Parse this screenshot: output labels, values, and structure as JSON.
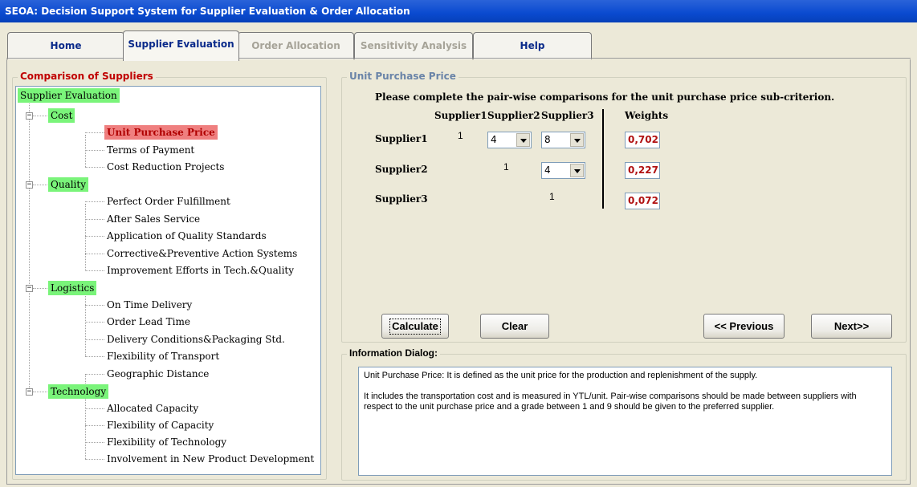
{
  "window": {
    "title": "SEOA: Decision Support System for Supplier Evaluation & Order Allocation"
  },
  "tabs": [
    {
      "label": "Home",
      "state": "enabled"
    },
    {
      "label": "Supplier Evaluation",
      "state": "active"
    },
    {
      "label": "Order Allocation",
      "state": "disabled"
    },
    {
      "label": "Sensitivity Analysis",
      "state": "disabled"
    },
    {
      "label": "Help",
      "state": "enabled"
    }
  ],
  "left_panel": {
    "title": "Comparison of Suppliers",
    "tree": {
      "root": "Supplier Evaluation",
      "categories": [
        {
          "label": "Cost",
          "children": [
            "Unit Purchase Price",
            "Terms of Payment",
            "Cost Reduction Projects"
          ]
        },
        {
          "label": "Quality",
          "children": [
            "Perfect Order Fulfillment",
            "After Sales Service",
            "Application of Quality Standards",
            "Corrective&Preventive Action Systems",
            "Improvement Efforts in Tech.&Quality"
          ]
        },
        {
          "label": "Logistics",
          "children": [
            "On Time Delivery",
            "Order Lead Time",
            "Delivery Conditions&Packaging Std.",
            "Flexibility of Transport",
            "Geographic Distance"
          ]
        },
        {
          "label": "Technology",
          "children": [
            "Allocated Capacity",
            "Flexibility of Capacity",
            "Flexibility of Technology",
            "Involvement in New Product Development"
          ]
        }
      ],
      "selected": "Unit Purchase Price",
      "expander_symbol": "−"
    }
  },
  "right_panel": {
    "title": "Unit Purchase Price",
    "instruction": "Please complete the pair-wise comparisons for the unit purchase price sub-criterion.",
    "column_headers": [
      "Supplier1",
      "Supplier2",
      "Supplier3"
    ],
    "weights_header": "Weights",
    "rows": [
      {
        "label": "Supplier1",
        "diag": "1",
        "comparisons": [
          "4",
          "8"
        ],
        "weight": "0,702"
      },
      {
        "label": "Supplier2",
        "diag": "1",
        "comparisons": [
          "4"
        ],
        "weight": "0,227"
      },
      {
        "label": "Supplier3",
        "diag": "1",
        "comparisons": [],
        "weight": "0,072"
      }
    ],
    "buttons": {
      "calculate": "Calculate",
      "clear": "Clear",
      "previous": "<< Previous",
      "next": "Next>>"
    }
  },
  "info_dialog": {
    "title": "Information Dialog:",
    "paragraphs": [
      "Unit Purchase Price: It is defined as the unit price for the production and replenishment of the supply.",
      "It includes the transportation cost and is measured in YTL/unit. Pair-wise comparisons should be made between suppliers with respect to the unit purchase price and a grade between 1 and 9 should be given to the preferred supplier."
    ]
  },
  "colors": {
    "category_highlight": "#7af47a",
    "selected_highlight": "#ef7f7f",
    "weight_text": "#b01010",
    "group_title": "#c00000",
    "group_title_alt": "#6a84a8"
  }
}
